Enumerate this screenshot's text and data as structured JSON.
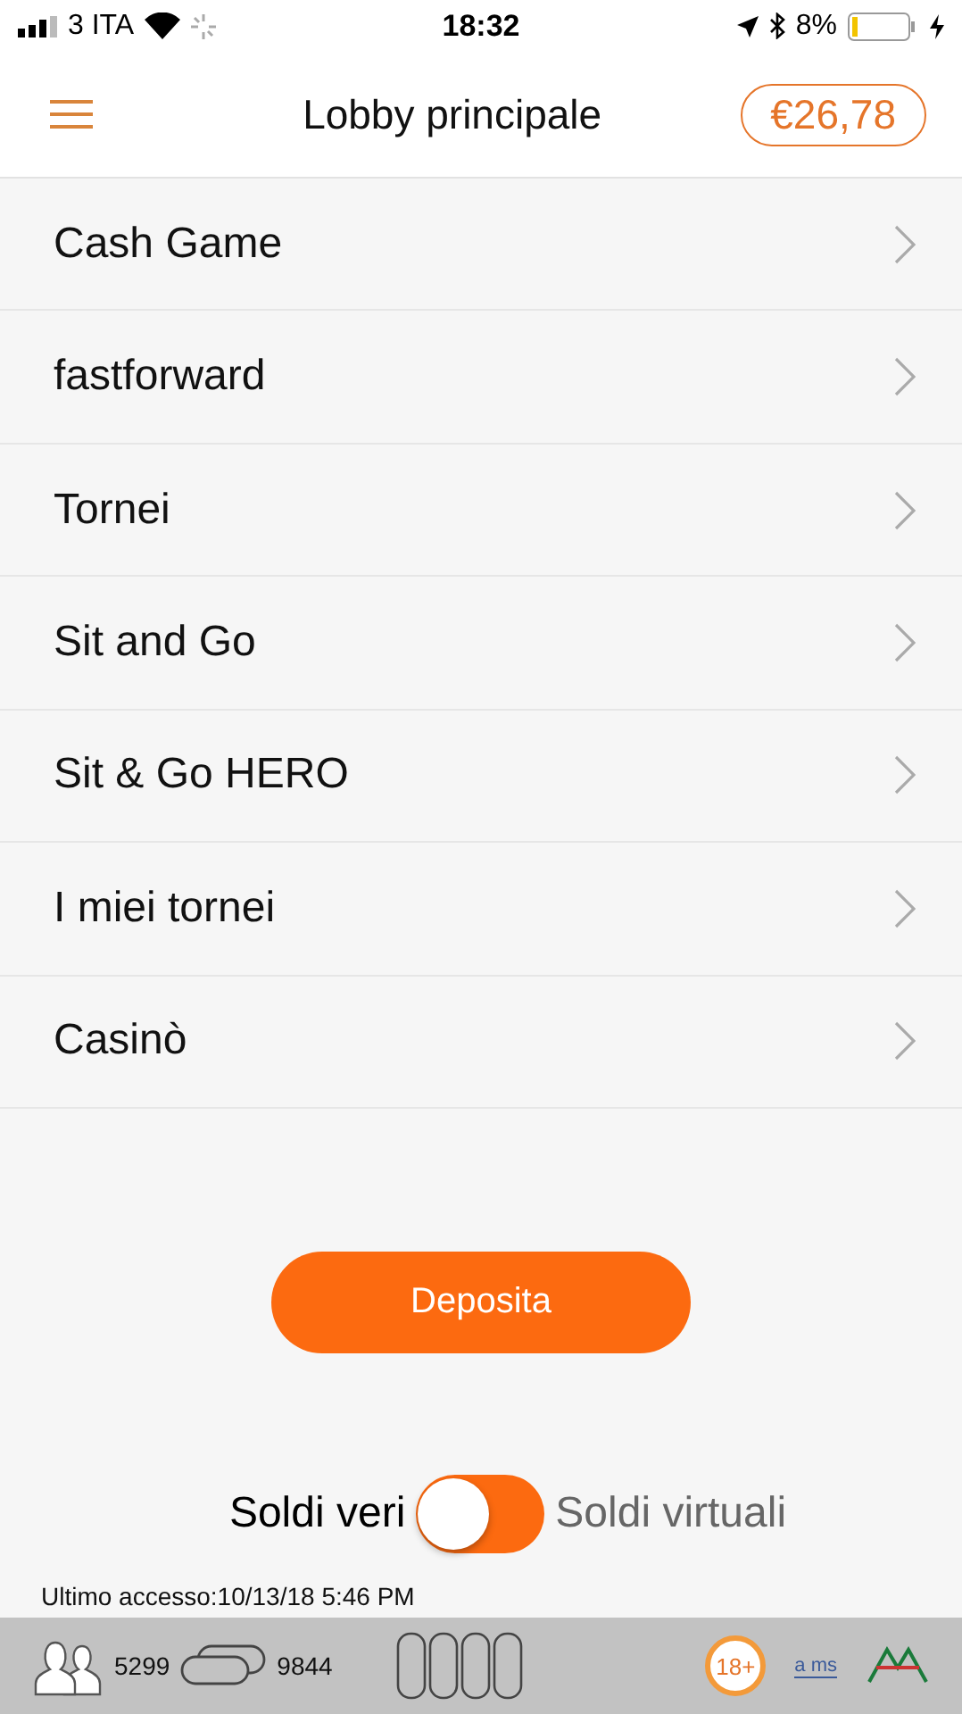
{
  "status_bar": {
    "carrier": "3 ITA",
    "time": "18:32",
    "battery": "8%"
  },
  "header": {
    "title": "Lobby principale",
    "balance": "€26,78"
  },
  "menu": [
    {
      "label": "Cash Game"
    },
    {
      "label": "fastforward"
    },
    {
      "label": "Tornei"
    },
    {
      "label": "Sit and Go"
    },
    {
      "label": "Sit & Go HERO"
    },
    {
      "label": "I miei tornei"
    },
    {
      "label": "Casinò"
    }
  ],
  "deposit_button": "Deposita",
  "money_toggle": {
    "left_label": "Soldi veri",
    "right_label": "Soldi virtuali",
    "on": true
  },
  "last_access": "Ultimo accesso:10/13/18 5:46 PM",
  "footer": {
    "players": "5299",
    "tables": "9844",
    "age_badge": "18+",
    "logo_text": "a ms"
  }
}
